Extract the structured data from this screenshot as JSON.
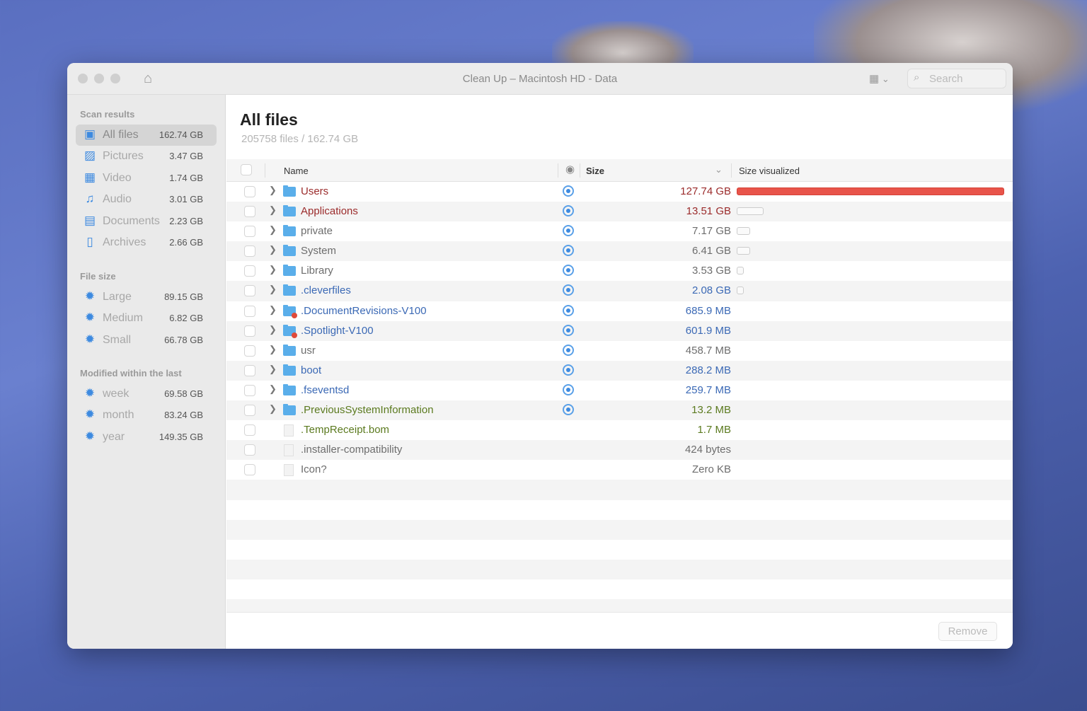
{
  "window": {
    "title": "Clean Up – Macintosh HD - Data",
    "search_placeholder": "Search"
  },
  "sidebar": {
    "sections": [
      {
        "title": "Scan results",
        "items": [
          {
            "label": "All files",
            "value": "162.74 GB",
            "icon": "all-files-icon",
            "selected": true
          },
          {
            "label": "Pictures",
            "value": "3.47 GB",
            "icon": "pictures-icon"
          },
          {
            "label": "Video",
            "value": "1.74 GB",
            "icon": "video-icon"
          },
          {
            "label": "Audio",
            "value": "3.01 GB",
            "icon": "audio-icon"
          },
          {
            "label": "Documents",
            "value": "2.23 GB",
            "icon": "documents-icon"
          },
          {
            "label": "Archives",
            "value": "2.66 GB",
            "icon": "archives-icon"
          }
        ]
      },
      {
        "title": "File size",
        "items": [
          {
            "label": "Large",
            "value": "89.15 GB",
            "icon": "gear-icon"
          },
          {
            "label": "Medium",
            "value": "6.82 GB",
            "icon": "gear-icon"
          },
          {
            "label": "Small",
            "value": "66.78 GB",
            "icon": "gear-icon"
          }
        ]
      },
      {
        "title": "Modified within the last",
        "items": [
          {
            "label": "week",
            "value": "69.58 GB",
            "icon": "gear-icon"
          },
          {
            "label": "month",
            "value": "83.24 GB",
            "icon": "gear-icon"
          },
          {
            "label": "year",
            "value": "149.35 GB",
            "icon": "gear-icon"
          }
        ]
      }
    ]
  },
  "main": {
    "title": "All files",
    "subtitle": "205758 files / 162.74 GB",
    "columns": {
      "name": "Name",
      "size": "Size",
      "visualized": "Size visualized"
    },
    "remove_label": "Remove",
    "colors": {
      "red": "#9b2b2b",
      "gray": "#6d6d6d",
      "blue": "#3b69b5",
      "green": "#5b7a1f",
      "bar": "#e8544a"
    },
    "rows": [
      {
        "name": "Users",
        "size": "127.74 GB",
        "color": "red",
        "folder": true,
        "bar": 1.0
      },
      {
        "name": "Applications",
        "size": "13.51 GB",
        "color": "red",
        "folder": true,
        "bar": 0.1
      },
      {
        "name": "private",
        "size": "7.17 GB",
        "color": "gray",
        "folder": true,
        "bar": 0.05
      },
      {
        "name": "System",
        "size": "6.41 GB",
        "color": "gray",
        "folder": true,
        "bar": 0.05
      },
      {
        "name": "Library",
        "size": "3.53 GB",
        "color": "gray",
        "folder": true,
        "bar": 0.025
      },
      {
        "name": ".cleverfiles",
        "size": "2.08 GB",
        "color": "blue",
        "folder": true,
        "bar": 0.025
      },
      {
        "name": ".DocumentRevisions-V100",
        "size": "685.9 MB",
        "color": "blue",
        "folder": true,
        "restricted": true
      },
      {
        "name": ".Spotlight-V100",
        "size": "601.9 MB",
        "color": "blue",
        "folder": true,
        "restricted": true
      },
      {
        "name": "usr",
        "size": "458.7 MB",
        "color": "gray",
        "folder": true
      },
      {
        "name": "boot",
        "size": "288.2 MB",
        "color": "blue",
        "folder": true
      },
      {
        "name": ".fseventsd",
        "size": "259.7 MB",
        "color": "blue",
        "folder": true
      },
      {
        "name": ".PreviousSystemInformation",
        "size": "13.2 MB",
        "color": "green",
        "folder": true
      },
      {
        "name": ".TempReceipt.bom",
        "size": "1.7 MB",
        "color": "green",
        "folder": false
      },
      {
        "name": ".installer-compatibility",
        "size": "424 bytes",
        "color": "gray",
        "folder": false
      },
      {
        "name": "Icon?",
        "size": "Zero KB",
        "color": "gray",
        "folder": false
      }
    ]
  }
}
